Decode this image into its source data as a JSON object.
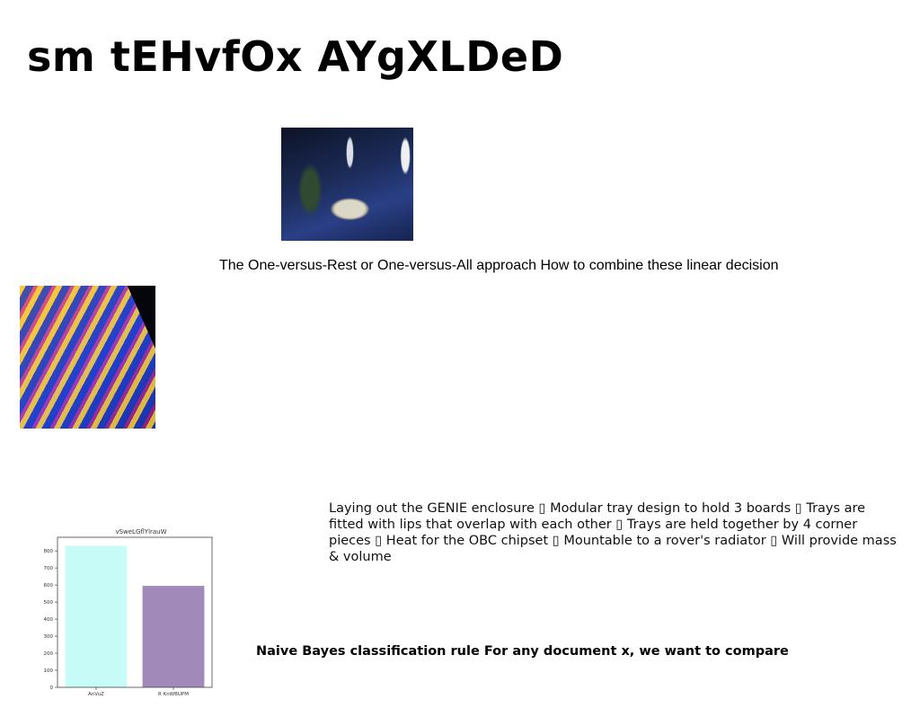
{
  "title": "sm tEHvfOx AYgXLDeD",
  "caption": "The One-versus-Rest or One-versus-All approach How to combine these linear decision",
  "paragraph": "Laying out the GENIE enclosure ▯ Modular tray design to hold 3 boards ▯ Trays are fitted with lips that overlap with each other ▯ Trays are held together by 4 corner pieces ▯ Heat for the OBC chipset ▯ Mountable to a rover's radiator ▯ Will provide mass & volume",
  "bold_line": "Naive Bayes classification rule For any document x, we want to compare",
  "chart_data": {
    "type": "bar",
    "title": "vSweLGflYlrauW",
    "categories": [
      "AnVuZ",
      "R KnWBUPM"
    ],
    "values": [
      830,
      595
    ],
    "colors": [
      "#c6fbf7",
      "#a18ab9"
    ],
    "ylim": [
      0,
      880
    ],
    "yticks": [
      0,
      100,
      200,
      300,
      400,
      500,
      600,
      700,
      800
    ],
    "xlabel": "",
    "ylabel": "",
    "grid": false
  }
}
